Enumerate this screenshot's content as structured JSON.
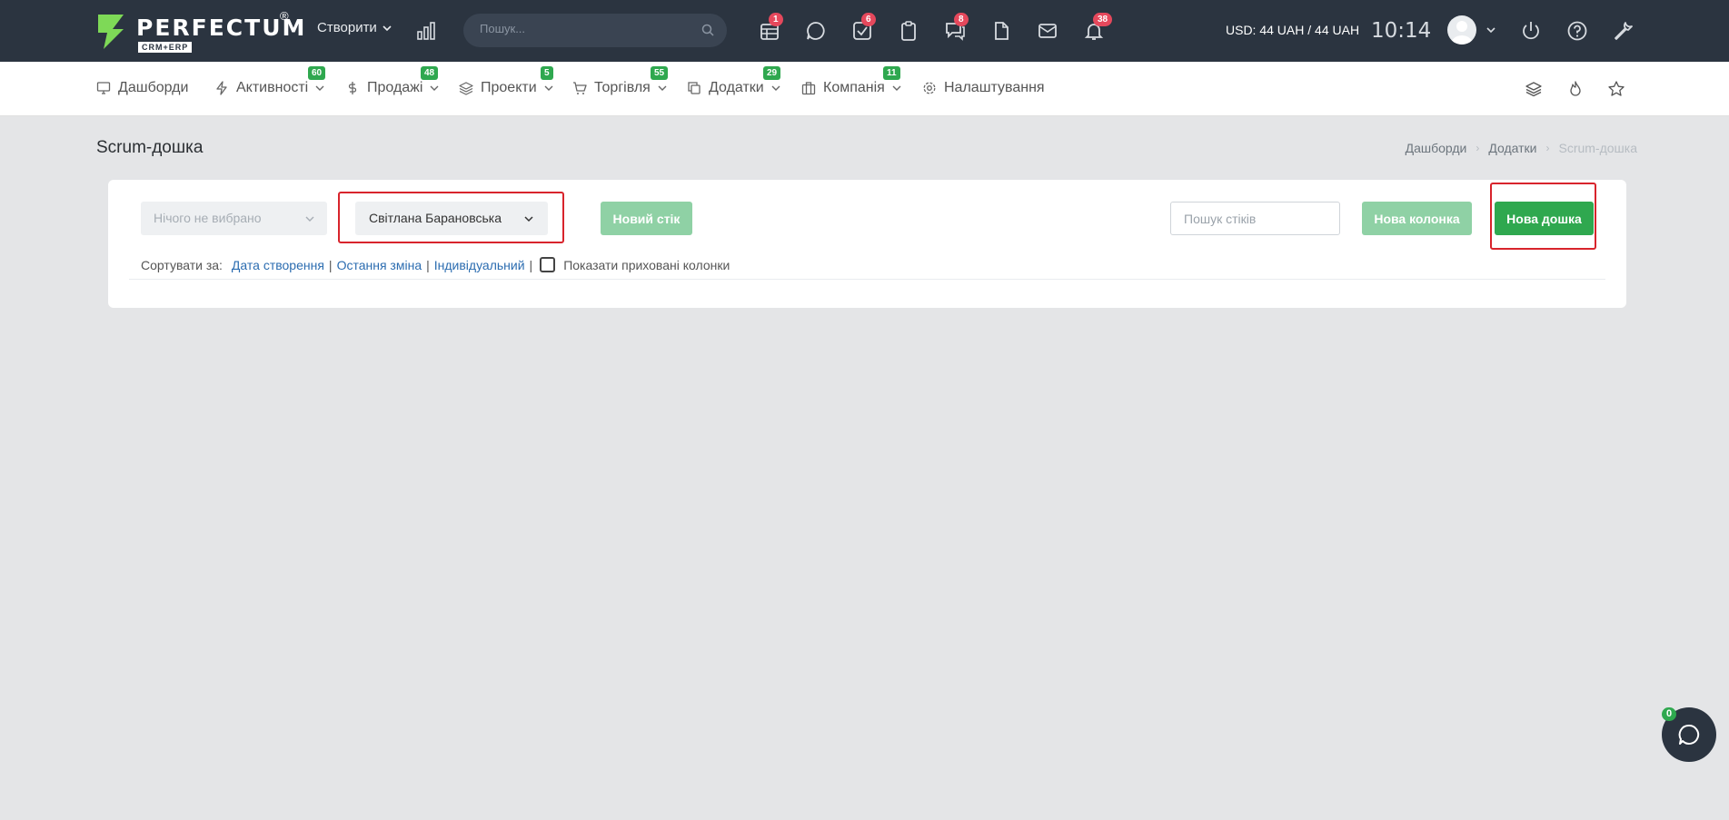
{
  "topbar": {
    "logo": {
      "name": "PERFECTUM",
      "reg": "®",
      "sub": "CRM+ERP"
    },
    "create_label": "Створити",
    "search_placeholder": "Пошук...",
    "badges": {
      "calendar": "1",
      "tasks": "6",
      "chat": "8",
      "notifications": "38"
    },
    "currency": "USD: 44 UAH / 44 UAH",
    "time": "10:14"
  },
  "nav": {
    "items": [
      {
        "label": "Дашборди",
        "badge": ""
      },
      {
        "label": "Активності",
        "badge": "60"
      },
      {
        "label": "Продажі",
        "badge": "48"
      },
      {
        "label": "Проекти",
        "badge": "5"
      },
      {
        "label": "Торгівля",
        "badge": "55"
      },
      {
        "label": "Додатки",
        "badge": "29"
      },
      {
        "label": "Компанія",
        "badge": "11"
      },
      {
        "label": "Налаштування",
        "badge": ""
      }
    ]
  },
  "page": {
    "title": "Scrum-дошка",
    "breadcrumb": [
      "Дашборди",
      "Додатки",
      "Scrum-дошка"
    ]
  },
  "toolbar": {
    "select_empty": "Нічого не вибрано",
    "select_user": "Світлана Барановська",
    "new_sticker": "Новий стік",
    "sticker_search_placeholder": "Пошук стіків",
    "new_column": "Нова колонка",
    "new_board": "Нова дошка"
  },
  "sort": {
    "label": "Сортувати за:",
    "options": [
      "Дата створення",
      "Остання зміна",
      "Індивідуальний"
    ],
    "show_hidden": "Показати приховані колонки"
  },
  "chat": {
    "badge": "0"
  },
  "colors": {
    "topbar": "#2b3440",
    "accent": "#2fa84f",
    "badge_red": "#e5485c",
    "highlight": "#d8242c"
  }
}
